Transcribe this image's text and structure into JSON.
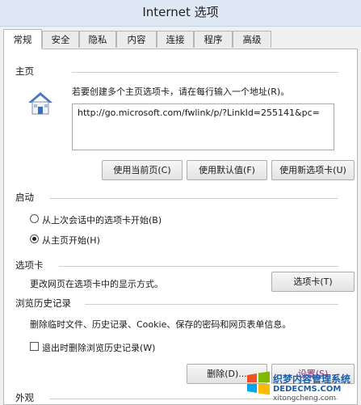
{
  "window": {
    "title": "Internet 选项"
  },
  "tabs": [
    {
      "label": "常规",
      "active": true
    },
    {
      "label": "安全",
      "active": false
    },
    {
      "label": "隐私",
      "active": false
    },
    {
      "label": "内容",
      "active": false
    },
    {
      "label": "连接",
      "active": false
    },
    {
      "label": "程序",
      "active": false
    },
    {
      "label": "高级",
      "active": false
    }
  ],
  "homepage": {
    "section_label": "主页",
    "instruction": "若要创建多个主页选项卡，请在每行输入一个地址(R)。",
    "url_value": "http://go.microsoft.com/fwlink/p/?LinkId=255141&pc=",
    "buttons": {
      "use_current": "使用当前页(C)",
      "use_default": "使用默认值(F)",
      "use_new_tab": "使用新选项卡(U)"
    }
  },
  "startup": {
    "section_label": "启动",
    "option_last_session": "从上次会话中的选项卡开始(B)",
    "option_homepage": "从主页开始(H)",
    "selected": "homepage"
  },
  "tabs_section": {
    "section_label": "选项卡",
    "description": "更改网页在选项卡中的显示方式。",
    "button": "选项卡(T)"
  },
  "history": {
    "section_label": "浏览历史记录",
    "description": "删除临时文件、历史记录、Cookie、保存的密码和网页表单信息。",
    "checkbox_label": "退出时删除浏览历史记录(W)",
    "checkbox_checked": false,
    "delete_button": "删除(D)...",
    "settings_button": "设置(S)"
  },
  "appearance": {
    "section_label": "外观"
  },
  "watermark": {
    "line1": "织梦内容管理系统",
    "line2": "DEDECMS.COM",
    "line3": "xitongcheng.com"
  }
}
